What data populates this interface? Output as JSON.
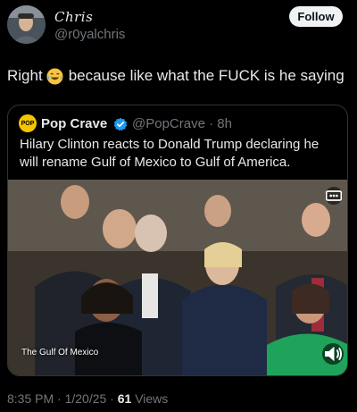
{
  "author": {
    "display_name": "Chris",
    "handle": "@r0yalchris"
  },
  "follow_label": "Follow",
  "post": {
    "text_before": "Right",
    "emoji": "face-with-tears-of-joy",
    "text_after": "because like what the FUCK is he saying"
  },
  "quoted": {
    "avatar_text": "POP",
    "name": "Pop Crave",
    "handle_time": "@PopCrave · 8h",
    "text": "Hilary Clinton reacts to Donald Trump declaring he will rename Gulf of Mexico to Gulf of America.",
    "video_caption": "The Gulf Of Mexico"
  },
  "meta": {
    "time_date": "8:35 PM · 1/20/25 · ",
    "views_count": "61",
    "views_label": " Views"
  },
  "colors": {
    "background": "#000000",
    "text": "#e7e9ea",
    "muted": "#71767b",
    "verified": "#1d9bf0",
    "follow_bg": "#eff3f4"
  }
}
